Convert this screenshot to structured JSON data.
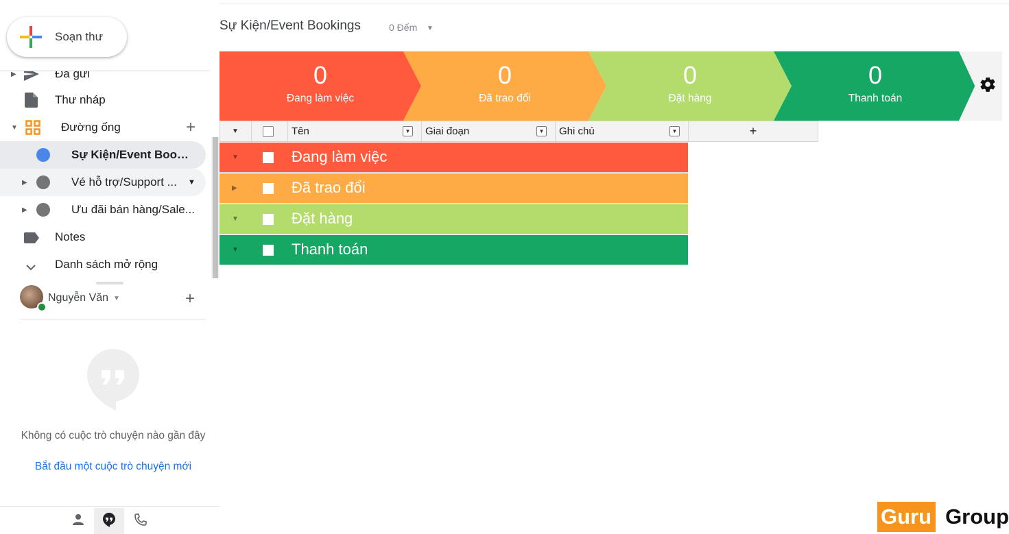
{
  "compose": {
    "label": "Soạn thư"
  },
  "nav": {
    "sent": "Đã gửi",
    "drafts": "Thư nháp",
    "pipelines": "Đường ống",
    "pipeline_items": [
      {
        "label": "Sự Kiện/Event Booki...",
        "dot_color": "#4a86e8"
      },
      {
        "label": "Vé hỗ trợ/Support ...",
        "dot_color": "#757575"
      },
      {
        "label": "Ưu đãi bán hàng/Sale...",
        "dot_color": "#757575"
      }
    ],
    "notes": "Notes",
    "more": "Danh sách mở rộng"
  },
  "hangouts": {
    "user_name": "Nguyễn Văn",
    "empty_message": "Không có cuộc trò chuyện nào gần đây",
    "start_link": "Bắt đầu một cuộc trò chuyện mới"
  },
  "header": {
    "title": "Sự Kiện/Event Bookings",
    "count": "0 Đếm"
  },
  "stages": [
    {
      "count": "0",
      "label": "Đang làm việc",
      "color": "#ff5a3d"
    },
    {
      "count": "0",
      "label": "Đã trao đổi",
      "color": "#ffab45"
    },
    {
      "count": "0",
      "label": "Đặt hàng",
      "color": "#b3dc6c"
    },
    {
      "count": "0",
      "label": "Thanh toán",
      "color": "#16a765"
    }
  ],
  "table": {
    "columns": {
      "name": "Tên",
      "stage": "Giai đoạn",
      "notes": "Ghi chú",
      "add": "+"
    },
    "groups": [
      {
        "label": "Đang làm việc",
        "color": "#ff5a3d"
      },
      {
        "label": "Đã trao đổi",
        "color": "#ffab45"
      },
      {
        "label": "Đặt hàng",
        "color": "#b3dc6c"
      },
      {
        "label": "Thanh toán",
        "color": "#16a765"
      }
    ]
  },
  "watermark": {
    "part1": "Guru",
    "part2": "Group"
  }
}
